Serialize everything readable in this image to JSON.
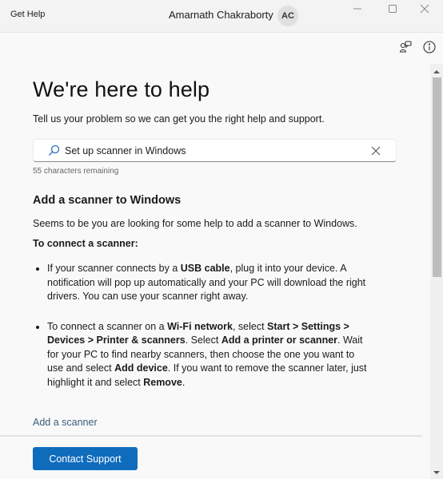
{
  "titlebar": {
    "app_title": "Get Help",
    "user_name": "Amarnath Chakraborty",
    "avatar_initials": "AC"
  },
  "toolbar": {
    "icons": [
      "community-icon",
      "info-icon"
    ]
  },
  "header": {
    "title": "We're here to help",
    "subtitle": "Tell us your problem so we can get you the right help and support."
  },
  "search": {
    "value": "Set up scanner in Windows",
    "chars_remaining": "55 characters remaining"
  },
  "answer": {
    "title": "Add a scanner to Windows",
    "intro": "Seems to be you are looking for some help to add a scanner to Windows.",
    "heading": "To connect a scanner:",
    "bullets": [
      [
        {
          "t": "If your scanner connects by a "
        },
        {
          "t": "USB cable",
          "b": true
        },
        {
          "t": ", plug it into your device. A notification will pop up automatically and your PC will download the right drivers. You can use your scanner right away."
        }
      ],
      [
        {
          "t": "To connect a scanner on a "
        },
        {
          "t": "Wi-Fi network",
          "b": true
        },
        {
          "t": ", select "
        },
        {
          "t": "Start > Settings > Devices > Printer & scanners",
          "b": true
        },
        {
          "t": ". Select "
        },
        {
          "t": "Add a printer or scanner",
          "b": true
        },
        {
          "t": ". Wait for your PC to find nearby scanners, then choose the one you want to use and select "
        },
        {
          "t": "Add device",
          "b": true
        },
        {
          "t": ". If you want to remove the scanner later, just highlight it and select "
        },
        {
          "t": "Remove",
          "b": true
        },
        {
          "t": "."
        }
      ]
    ],
    "link": "Add a scanner"
  },
  "footer": {
    "contact_label": "Contact Support"
  },
  "colors": {
    "accent": "#0f6cbd",
    "link": "#3b5c7e",
    "background": "#f9f9f9"
  }
}
